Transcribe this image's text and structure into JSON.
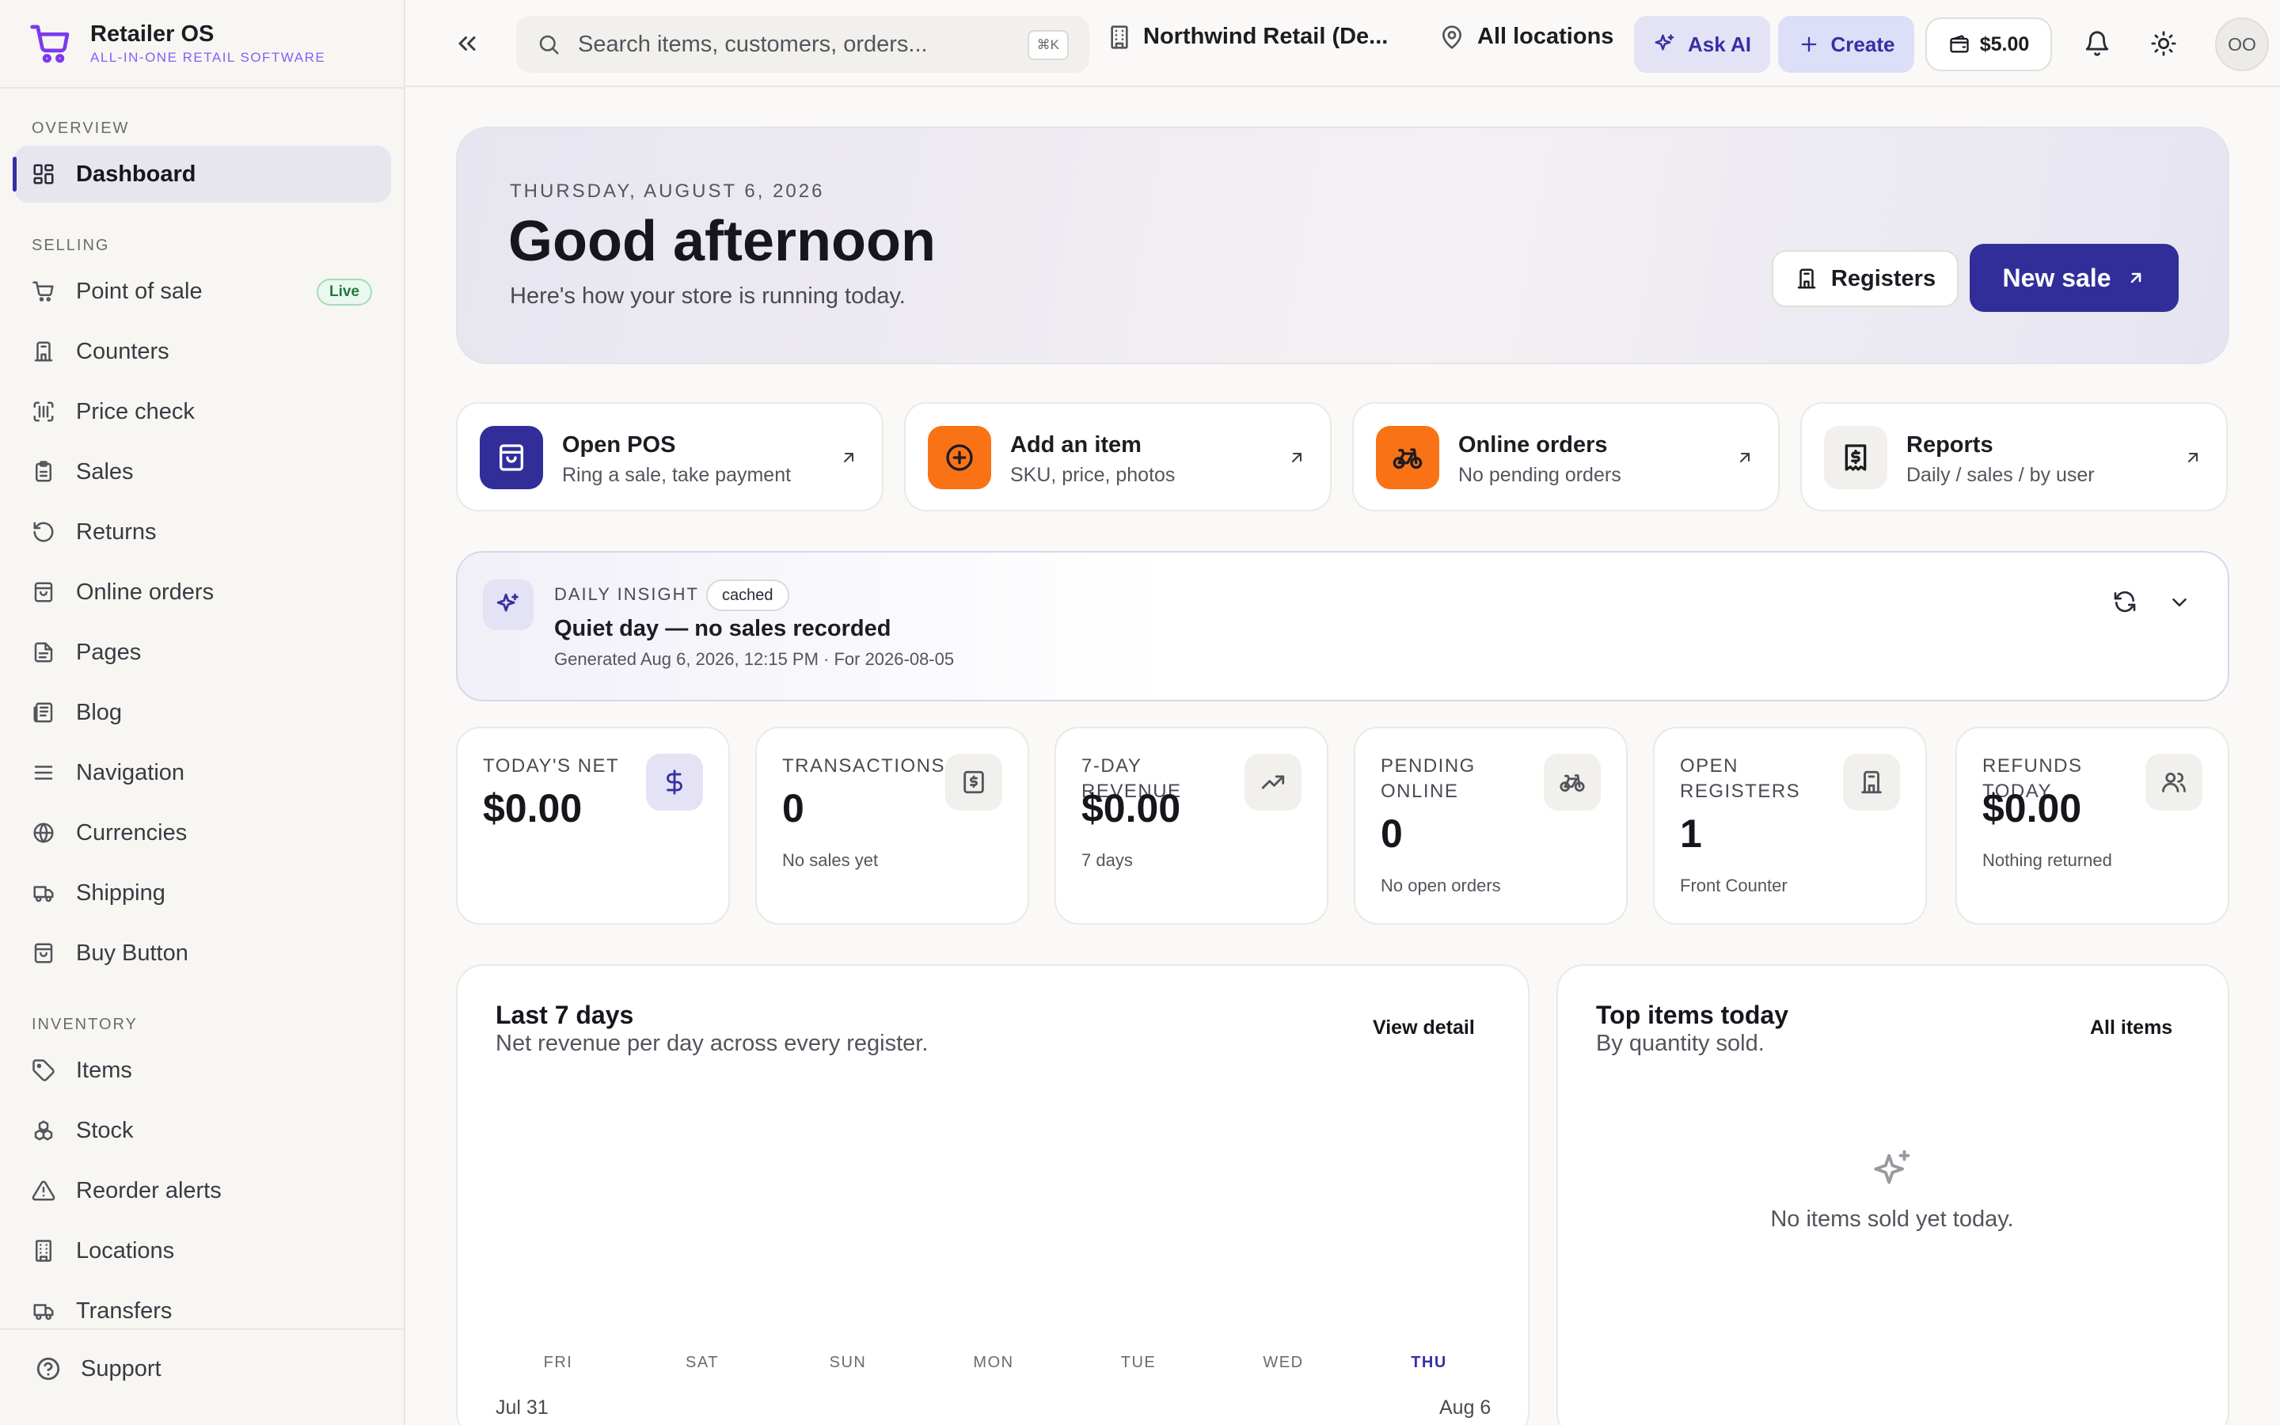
{
  "brand": {
    "name": "Retailer OS",
    "tagline": "ALL-IN-ONE RETAIL SOFTWARE"
  },
  "sidebar": {
    "sections": [
      {
        "title": "OVERVIEW",
        "items": [
          {
            "label": "Dashboard",
            "icon": "grid-icon",
            "active": true
          }
        ]
      },
      {
        "title": "SELLING",
        "items": [
          {
            "label": "Point of sale",
            "icon": "cart-icon",
            "badge": "Live"
          },
          {
            "label": "Counters",
            "icon": "register-icon"
          },
          {
            "label": "Price check",
            "icon": "barcode-icon"
          },
          {
            "label": "Sales",
            "icon": "clipboard-icon"
          },
          {
            "label": "Returns",
            "icon": "undo-icon"
          },
          {
            "label": "Online orders",
            "icon": "shopping-bag-icon"
          },
          {
            "label": "Pages",
            "icon": "file-icon"
          },
          {
            "label": "Blog",
            "icon": "newspaper-icon"
          },
          {
            "label": "Navigation",
            "icon": "menu-icon"
          },
          {
            "label": "Currencies",
            "icon": "globe-icon"
          },
          {
            "label": "Shipping",
            "icon": "truck-icon"
          },
          {
            "label": "Buy Button",
            "icon": "shopping-bag-icon"
          }
        ]
      },
      {
        "title": "INVENTORY",
        "items": [
          {
            "label": "Items",
            "icon": "tag-icon"
          },
          {
            "label": "Stock",
            "icon": "boxes-icon"
          },
          {
            "label": "Reorder alerts",
            "icon": "alert-triangle-icon"
          },
          {
            "label": "Locations",
            "icon": "building-icon"
          },
          {
            "label": "Transfers",
            "icon": "truck-icon"
          }
        ]
      }
    ],
    "support": "Support"
  },
  "topbar": {
    "search_placeholder": "Search items, customers, orders...",
    "search_shortcut": "⌘K",
    "org": "Northwind Retail (De...",
    "location": "All locations",
    "ask_ai": "Ask AI",
    "create": "Create",
    "wallet": "$5.00",
    "avatar_initials": "OO"
  },
  "hero": {
    "date": "THURSDAY, AUGUST 6, 2026",
    "greeting": "Good afternoon",
    "subtitle": "Here's how your store is running today.",
    "registers_label": "Registers",
    "new_sale_label": "New sale"
  },
  "quick_actions": [
    {
      "title": "Open POS",
      "subtitle": "Ring a sale, take payment",
      "icon": "shopping-bag-icon",
      "bg": "#312e9a",
      "fg": "#ffffff"
    },
    {
      "title": "Add an item",
      "subtitle": "SKU, price, photos",
      "icon": "plus-circle-icon",
      "bg": "#f97316",
      "fg": "#1c1c22"
    },
    {
      "title": "Online orders",
      "subtitle": "No pending orders",
      "icon": "bicycle-icon",
      "bg": "#f97316",
      "fg": "#1c1c22"
    },
    {
      "title": "Reports",
      "subtitle": "Daily / sales / by user",
      "icon": "receipt-icon",
      "bg": "#f1f0ed",
      "fg": "#1c1c22"
    }
  ],
  "insight": {
    "label": "DAILY INSIGHT",
    "badge": "cached",
    "title": "Quiet day — no sales recorded",
    "meta": "Generated Aug 6, 2026, 12:15 PM · For 2026-08-05"
  },
  "stats": [
    {
      "label": "TODAY'S NET",
      "value": "$0.00",
      "note": "",
      "icon": "dollar-icon",
      "accent": true
    },
    {
      "label": "TRANSACTIONS",
      "value": "0",
      "note": "No sales yet",
      "icon": "receipt-icon"
    },
    {
      "label": "7-DAY REVENUE",
      "value": "$0.00",
      "note": "7 days",
      "icon": "trending-up-icon"
    },
    {
      "label": "PENDING ONLINE",
      "value": "0",
      "note": "No open orders",
      "icon": "bicycle-icon"
    },
    {
      "label": "OPEN REGISTERS",
      "value": "1",
      "note": "Front Counter",
      "icon": "register-icon"
    },
    {
      "label": "REFUNDS TODAY",
      "value": "$0.00",
      "note": "Nothing returned",
      "icon": "users-icon"
    }
  ],
  "revenue_panel": {
    "title": "Last 7 days",
    "subtitle": "Net revenue per day across every register.",
    "link": "View detail",
    "days": [
      "FRI",
      "SAT",
      "SUN",
      "MON",
      "TUE",
      "WED",
      "THU"
    ],
    "range_start": "Jul 31",
    "range_end": "Aug 6"
  },
  "top_items_panel": {
    "title": "Top items today",
    "subtitle": "By quantity sold.",
    "link": "All items",
    "empty": "No items sold yet today."
  }
}
